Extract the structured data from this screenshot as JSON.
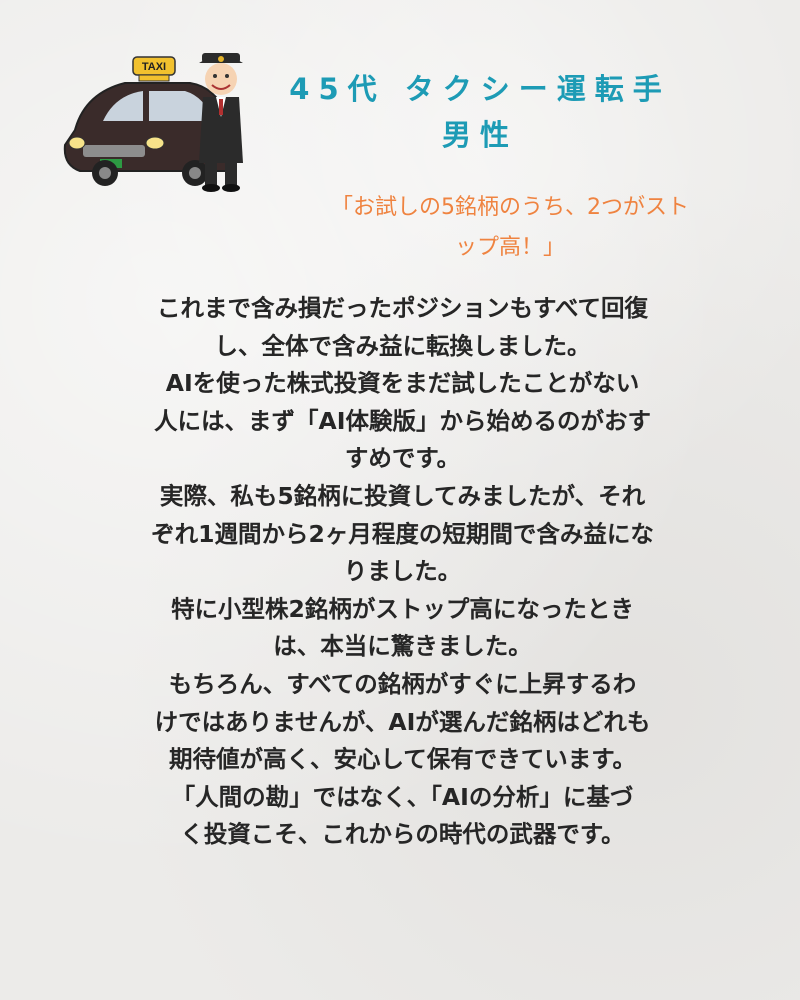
{
  "header": {
    "title_line1": "45代 タクシー運転手",
    "title_line2": "男性"
  },
  "illustration": {
    "taxi_sign": "TAXI",
    "icon": "taxi-driver-icon"
  },
  "quote": {
    "line1": "「お試しの5銘柄のうち、2つがスト",
    "line2": "ップ高！」"
  },
  "body": {
    "lines": [
      "これまで含み損だったポジションもすべて回復",
      "し、全体で含み益に転換しました。",
      "AIを使った株式投資をまだ試したことがない",
      "人には、まず「AI体験版」から始めるのがおす",
      "すめです。",
      "実際、私も5銘柄に投資してみましたが、それ",
      "ぞれ1週間から2ヶ月程度の短期間で含み益にな",
      "りました。",
      "特に小型株2銘柄がストップ高になったとき",
      "は、本当に驚きました。",
      "もちろん、すべての銘柄がすぐに上昇するわ",
      "けではありませんが、AIが選んだ銘柄はどれも",
      "期待値が高く、安心して保有できています。",
      "「人間の勘」ではなく、「AIの分析」に基づ",
      "く投資こそ、これからの時代の武器です。"
    ]
  },
  "colors": {
    "title": "#1d9bb5",
    "quote": "#ef8340",
    "body": "#262626"
  }
}
